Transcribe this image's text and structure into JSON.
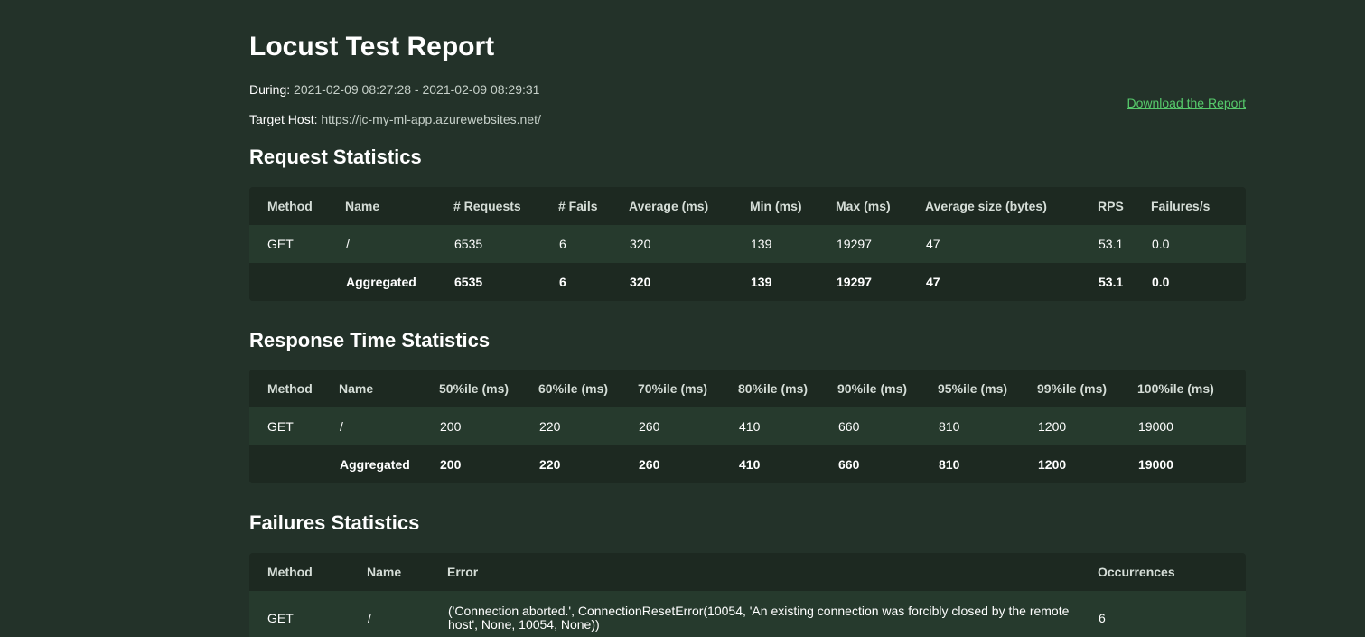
{
  "report": {
    "title": "Locust Test Report",
    "during_label": "During:",
    "during_value": "2021-02-09 08:27:28 - 2021-02-09 08:29:31",
    "host_label": "Target Host:",
    "host_value": "https://jc-my-ml-app.azurewebsites.net/",
    "download_label": "Download the Report"
  },
  "request_stats": {
    "title": "Request Statistics",
    "headers": [
      "Method",
      "Name",
      "# Requests",
      "# Fails",
      "Average (ms)",
      "Min (ms)",
      "Max (ms)",
      "Average size (bytes)",
      "RPS",
      "Failures/s"
    ],
    "rows": [
      [
        "GET",
        "/",
        "6535",
        "6",
        "320",
        "139",
        "19297",
        "47",
        "53.1",
        "0.0"
      ]
    ],
    "aggregated": [
      "",
      "Aggregated",
      "6535",
      "6",
      "320",
      "139",
      "19297",
      "47",
      "53.1",
      "0.0"
    ]
  },
  "response_stats": {
    "title": "Response Time Statistics",
    "headers": [
      "Method",
      "Name",
      "50%ile (ms)",
      "60%ile (ms)",
      "70%ile (ms)",
      "80%ile (ms)",
      "90%ile (ms)",
      "95%ile (ms)",
      "99%ile (ms)",
      "100%ile (ms)"
    ],
    "rows": [
      [
        "GET",
        "/",
        "200",
        "220",
        "260",
        "410",
        "660",
        "810",
        "1200",
        "19000"
      ]
    ],
    "aggregated": [
      "",
      "Aggregated",
      "200",
      "220",
      "260",
      "410",
      "660",
      "810",
      "1200",
      "19000"
    ]
  },
  "failure_stats": {
    "title": "Failures Statistics",
    "headers": [
      "Method",
      "Name",
      "Error",
      "Occurrences"
    ],
    "rows": [
      [
        "GET",
        "/",
        "('Connection aborted.', ConnectionResetError(10054, 'An existing connection was forcibly closed by the remote host', None, 10054, None))",
        "6"
      ]
    ]
  }
}
